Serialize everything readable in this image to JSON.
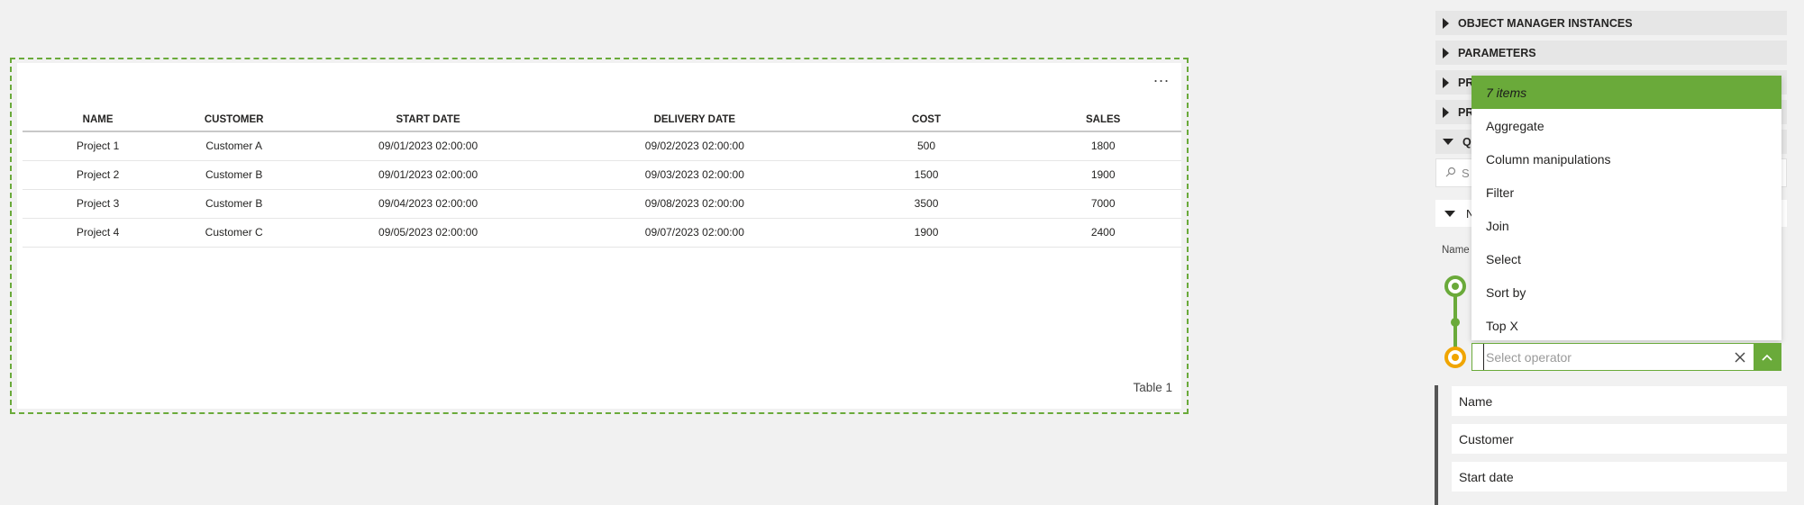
{
  "visual": {
    "title": "Table 1",
    "more_label": "...",
    "columns": [
      "NAME",
      "CUSTOMER",
      "START DATE",
      "DELIVERY DATE",
      "COST",
      "SALES"
    ],
    "rows": [
      [
        "Project 1",
        "Customer A",
        "09/01/2023 02:00:00",
        "09/02/2023 02:00:00",
        "500",
        "1800"
      ],
      [
        "Project 2",
        "Customer B",
        "09/01/2023 02:00:00",
        "09/03/2023 02:00:00",
        "1500",
        "1900"
      ],
      [
        "Project 3",
        "Customer B",
        "09/04/2023 02:00:00",
        "09/08/2023 02:00:00",
        "3500",
        "7000"
      ],
      [
        "Project 4",
        "Customer C",
        "09/05/2023 02:00:00",
        "09/07/2023 02:00:00",
        "1900",
        "2400"
      ]
    ]
  },
  "pane": {
    "sections": [
      {
        "label": "OBJECT MANAGER INSTANCES",
        "expanded": false
      },
      {
        "label": "PARAMETERS",
        "expanded": false
      },
      {
        "label": "PR",
        "expanded": false
      },
      {
        "label": "PR",
        "expanded": false
      },
      {
        "label": "QU",
        "expanded": true
      }
    ],
    "search_placeholder": "S",
    "subsection_label": "N",
    "name_label": "Name",
    "accent": "#6aaa3a",
    "node_colors": [
      "#6aaa3a",
      "#f0a500"
    ]
  },
  "dropdown": {
    "header": "7 items",
    "items": [
      "Aggregate",
      "Column manipulations",
      "Filter",
      "Join",
      "Select",
      "Sort by",
      "Top X"
    ],
    "input_placeholder": "Select operator"
  },
  "fields": [
    "Name",
    "Customer",
    "Start date"
  ]
}
